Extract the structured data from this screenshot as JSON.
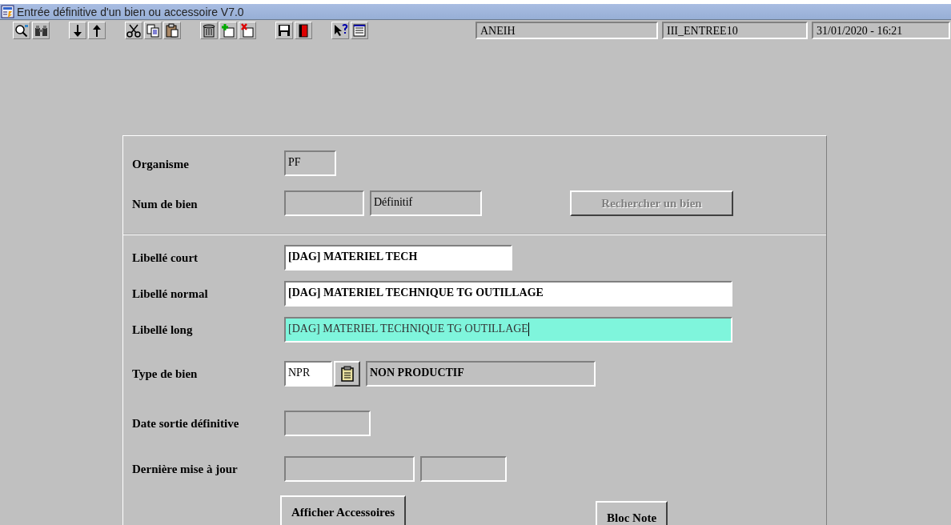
{
  "window": {
    "title": "Entrée définitive d'un bien ou accessoire V7.0"
  },
  "status_fields": [
    {
      "value": "ANEIH"
    },
    {
      "value": "III_ENTREE10"
    },
    {
      "value": "31/01/2020 - 16:21"
    }
  ],
  "form": {
    "sections": [
      {
        "rows": [
          {
            "label": "Organisme",
            "items": [
              {
                "kind": "readonly",
                "value": "PF"
              }
            ]
          },
          {
            "label": "Num de bien",
            "items": [
              {
                "kind": "readonly"
              },
              {
                "kind": "readonly",
                "value": "Définitif"
              },
              {
                "kind": "button",
                "label": "Rechercher un bien",
                "disabled": true
              }
            ]
          }
        ]
      },
      {
        "rows": [
          {
            "label": "Libellé court",
            "items": [
              {
                "kind": "entry",
                "value": "[DAG] MATERIEL TECH",
                "focused": false
              }
            ]
          },
          {
            "label": "Libellé normal",
            "items": [
              {
                "kind": "entry",
                "value": "[DAG] MATERIEL TECHNIQUE TG OUTILLAGE",
                "focused": false
              }
            ]
          },
          {
            "label": "Libellé long",
            "items": [
              {
                "kind": "entry",
                "value": "[DAG] MATERIEL TECHNIQUE TG OUTILLAGE",
                "focused": true
              }
            ]
          },
          {
            "label": "Type de bien",
            "items": [
              {
                "kind": "code",
                "value": "NPR"
              },
              {
                "kind": "lookup"
              },
              {
                "kind": "description",
                "value": "NON PRODUCTIF"
              }
            ]
          },
          {
            "label": "Date sortie définitive",
            "items": [
              {
                "kind": "readonly"
              }
            ]
          },
          {
            "label": "Dernière mise à jour",
            "items": [
              {
                "kind": "readonly"
              },
              {
                "kind": "readonly"
              }
            ]
          }
        ]
      }
    ],
    "buttons": [
      {
        "label": "Afficher Accessoires",
        "disabled": false
      },
      {
        "label": "Bloc Note",
        "disabled": false
      }
    ]
  }
}
